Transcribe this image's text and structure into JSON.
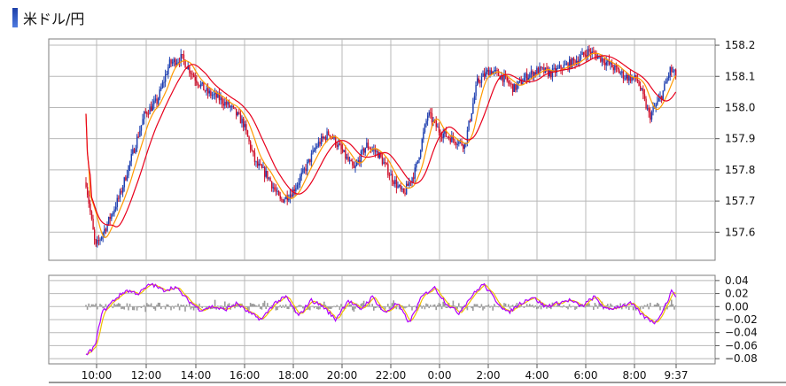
{
  "title": "米ドル/円",
  "colors": {
    "ma_short": "#ff9a00",
    "ma_long": "#e8001c",
    "candle_up": "#1e3fb0",
    "candle_down": "#d0102a",
    "osc_main": "#b000ff",
    "osc_signal": "#f0c000",
    "osc_hist": "#9a9a9a",
    "grid": "#b8b8b8"
  },
  "chart_data": [
    {
      "type": "candlestick",
      "title": "",
      "x_tick_labels": [
        "10:00",
        "12:00",
        "14:00",
        "16:00",
        "18:00",
        "20:00",
        "22:00",
        "0:00",
        "2:00",
        "4:00",
        "6:00",
        "8:00",
        "9:37"
      ],
      "y_tick_labels": [
        "158.2",
        "158.1",
        "158.0",
        "157.9",
        "157.8",
        "157.7",
        "157.6"
      ],
      "ylim": [
        157.51,
        158.22
      ],
      "grid": true,
      "price_path": [
        [
          "9:37",
          157.76
        ],
        [
          "10:00",
          157.55
        ],
        [
          "10:30",
          157.63
        ],
        [
          "11:00",
          157.72
        ],
        [
          "11:30",
          157.85
        ],
        [
          "12:00",
          157.98
        ],
        [
          "12:30",
          158.02
        ],
        [
          "13:00",
          158.14
        ],
        [
          "13:30",
          158.16
        ],
        [
          "14:00",
          158.1
        ],
        [
          "14:30",
          158.05
        ],
        [
          "15:00",
          158.03
        ],
        [
          "15:30",
          158.0
        ],
        [
          "16:00",
          157.95
        ],
        [
          "16:30",
          157.82
        ],
        [
          "17:00",
          157.78
        ],
        [
          "17:30",
          157.7
        ],
        [
          "18:00",
          157.73
        ],
        [
          "18:30",
          157.8
        ],
        [
          "19:00",
          157.88
        ],
        [
          "19:30",
          157.92
        ],
        [
          "20:00",
          157.86
        ],
        [
          "20:30",
          157.8
        ],
        [
          "21:00",
          157.88
        ],
        [
          "21:30",
          157.85
        ],
        [
          "22:00",
          157.78
        ],
        [
          "22:30",
          157.72
        ],
        [
          "23:00",
          157.8
        ],
        [
          "23:30",
          157.98
        ],
        [
          "0:00",
          157.92
        ],
        [
          "0:30",
          157.9
        ],
        [
          "1:00",
          157.88
        ],
        [
          "1:30",
          158.08
        ],
        [
          "2:00",
          158.12
        ],
        [
          "2:30",
          158.1
        ],
        [
          "3:00",
          158.06
        ],
        [
          "3:30",
          158.1
        ],
        [
          "4:00",
          158.12
        ],
        [
          "4:30",
          158.11
        ],
        [
          "5:00",
          158.13
        ],
        [
          "5:30",
          158.15
        ],
        [
          "6:00",
          158.18
        ],
        [
          "6:30",
          158.16
        ],
        [
          "7:00",
          158.13
        ],
        [
          "7:30",
          158.1
        ],
        [
          "8:00",
          158.09
        ],
        [
          "8:15",
          158.03
        ],
        [
          "8:30",
          157.97
        ],
        [
          "9:00",
          158.04
        ],
        [
          "9:20",
          158.12
        ],
        [
          "9:37",
          158.1
        ]
      ],
      "series": [
        {
          "name": "",
          "kind": "short moving average"
        },
        {
          "name": "",
          "kind": "long moving average"
        }
      ]
    },
    {
      "type": "line",
      "title": "",
      "y_tick_labels": [
        "0.04",
        "0.02",
        "0.00",
        "−0.02",
        "−0.04",
        "−0.06",
        "−0.08"
      ],
      "ylim": [
        -0.088,
        0.048
      ],
      "grid": true,
      "oscillator_path": [
        [
          "9:37",
          -0.075
        ],
        [
          "10:00",
          -0.06
        ],
        [
          "10:15",
          -0.01
        ],
        [
          "10:45",
          0.01
        ],
        [
          "11:15",
          0.025
        ],
        [
          "11:45",
          0.02
        ],
        [
          "12:15",
          0.035
        ],
        [
          "12:45",
          0.025
        ],
        [
          "13:15",
          0.03
        ],
        [
          "13:45",
          0.01
        ],
        [
          "14:15",
          -0.005
        ],
        [
          "14:45",
          0.0
        ],
        [
          "15:15",
          -0.005
        ],
        [
          "15:45",
          0.005
        ],
        [
          "16:15",
          -0.01
        ],
        [
          "16:45",
          -0.02
        ],
        [
          "17:15",
          0.005
        ],
        [
          "17:45",
          0.015
        ],
        [
          "18:15",
          -0.015
        ],
        [
          "18:45",
          0.01
        ],
        [
          "19:15",
          0.0
        ],
        [
          "19:45",
          -0.02
        ],
        [
          "20:15",
          0.01
        ],
        [
          "20:45",
          -0.005
        ],
        [
          "21:15",
          0.015
        ],
        [
          "21:45",
          -0.01
        ],
        [
          "22:15",
          0.005
        ],
        [
          "22:45",
          -0.025
        ],
        [
          "23:15",
          0.015
        ],
        [
          "23:45",
          0.03
        ],
        [
          "0:15",
          0.005
        ],
        [
          "0:45",
          -0.01
        ],
        [
          "1:15",
          0.015
        ],
        [
          "1:45",
          0.035
        ],
        [
          "2:15",
          0.01
        ],
        [
          "2:45",
          -0.01
        ],
        [
          "3:15",
          0.005
        ],
        [
          "3:45",
          0.015
        ],
        [
          "4:15",
          0.0
        ],
        [
          "4:45",
          0.005
        ],
        [
          "5:15",
          0.01
        ],
        [
          "5:45",
          0.0
        ],
        [
          "6:15",
          0.015
        ],
        [
          "6:45",
          -0.005
        ],
        [
          "7:15",
          0.0
        ],
        [
          "7:45",
          0.005
        ],
        [
          "8:15",
          -0.015
        ],
        [
          "8:45",
          -0.025
        ],
        [
          "9:15",
          0.01
        ],
        [
          "9:25",
          0.025
        ],
        [
          "9:37",
          0.015
        ]
      ],
      "series": [
        {
          "name": "",
          "kind": "oscillator main line"
        },
        {
          "name": "",
          "kind": "signal line"
        },
        {
          "name": "",
          "kind": "histogram"
        }
      ]
    }
  ]
}
